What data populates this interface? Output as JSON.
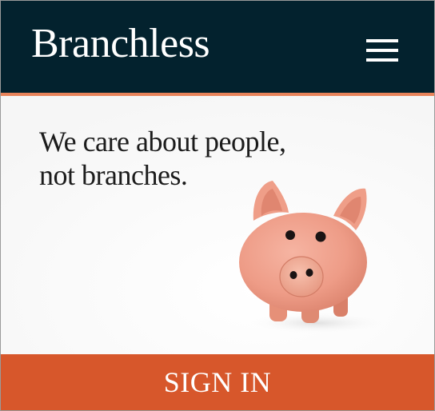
{
  "header": {
    "logo_text": "Branchless",
    "menu_icon": "hamburger-menu-icon",
    "background_color": "#03222e",
    "accent_color": "#e8835a"
  },
  "hero": {
    "tagline_line1": "We care about people,",
    "tagline_line2": "not branches.",
    "image": "piggy-bank"
  },
  "cta": {
    "sign_in_label": "SIGN IN",
    "background_color": "#d7572b"
  }
}
